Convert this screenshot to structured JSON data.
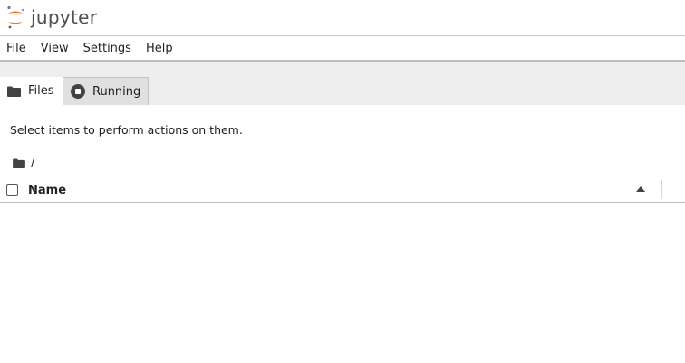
{
  "app": {
    "logo_text": "jupyter",
    "brand_color": "#f37726"
  },
  "menu": {
    "items": [
      {
        "label": "File"
      },
      {
        "label": "View"
      },
      {
        "label": "Settings"
      },
      {
        "label": "Help"
      }
    ]
  },
  "tabs": [
    {
      "label": "Files",
      "icon": "folder-icon",
      "active": true
    },
    {
      "label": "Running",
      "icon": "stop-circle-icon",
      "active": false
    }
  ],
  "filebrowser": {
    "hint": "Select items to perform actions on them.",
    "breadcrumb_path": "/",
    "column_name": "Name",
    "sort": "ascending"
  }
}
